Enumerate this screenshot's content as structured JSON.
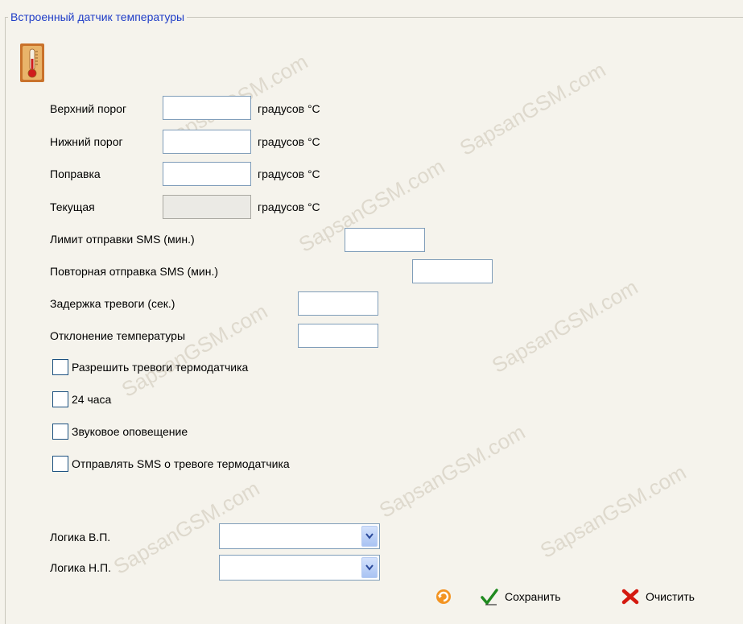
{
  "group": {
    "title": "Встроенный датчик температуры"
  },
  "fields": [
    {
      "label": "Верхний порог",
      "unit": "градусов °C",
      "value": ""
    },
    {
      "label": "Нижний порог",
      "unit": "градусов °C",
      "value": ""
    },
    {
      "label": "Поправка",
      "unit": "градусов °C",
      "value": ""
    },
    {
      "label": "Текущая",
      "unit": "градусов °C",
      "value": ""
    }
  ],
  "sms_limit": {
    "label": "Лимит отправки SMS (мин.)",
    "value": ""
  },
  "sms_repeat": {
    "label": "Повторная отправка SMS (мин.)",
    "value": ""
  },
  "alarm_delay": {
    "label": "Задержка тревоги (сек.)",
    "value": ""
  },
  "temp_deviation": {
    "label": "Отклонение температуры",
    "value": ""
  },
  "checkboxes": [
    {
      "label": "Разрешить тревоги термодатчика",
      "checked": false
    },
    {
      "label": "24 часа",
      "checked": false
    },
    {
      "label": "Звуковое оповещение",
      "checked": false
    },
    {
      "label": "Отправлять SMS о тревоге термодатчика",
      "checked": false
    }
  ],
  "logic_upper": {
    "label": "Логика В.П.",
    "value": ""
  },
  "logic_lower": {
    "label": "Логика Н.П.",
    "value": ""
  },
  "actions": {
    "refresh_icon": "refresh-icon",
    "save_label": "Сохранить",
    "clear_label": "Очистить"
  },
  "watermark": "SapsanGSM.com",
  "colors": {
    "accent": "#1f3dc7",
    "background": "#f5f3ec",
    "input_border": "#7f9db9"
  }
}
